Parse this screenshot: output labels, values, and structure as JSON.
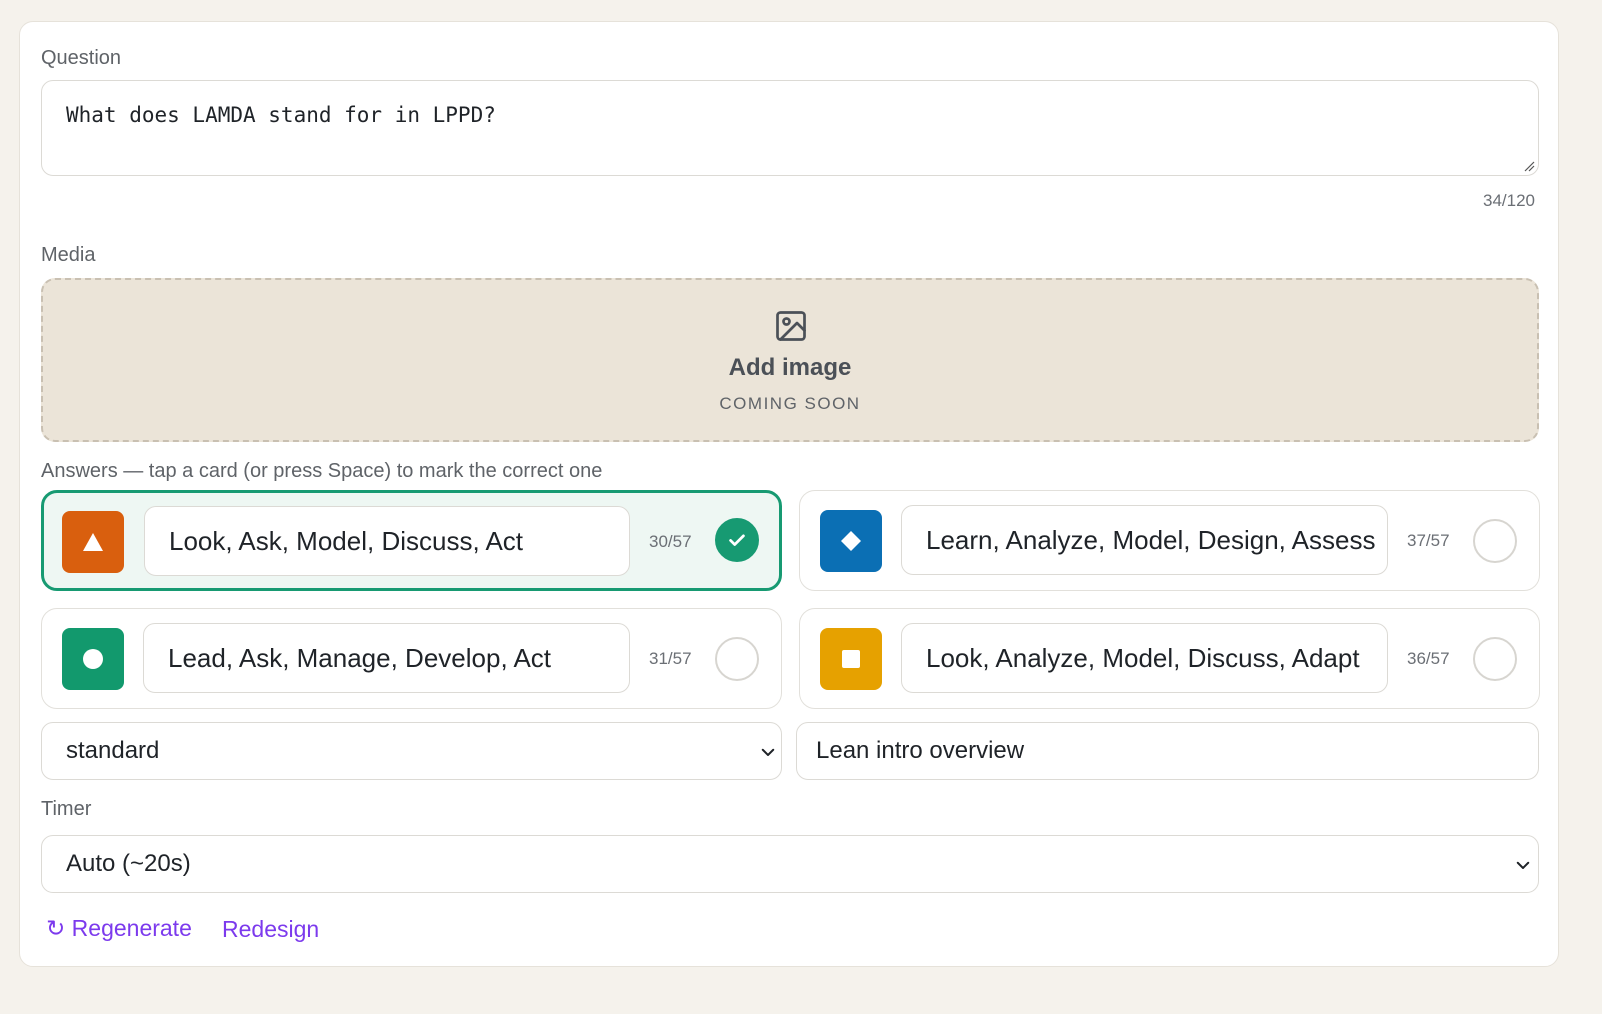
{
  "question": {
    "label": "Question",
    "value": "What does LAMDA stand for in LPPD?",
    "counter": "34/120"
  },
  "media": {
    "label": "Media",
    "title": "Add image",
    "subtitle": "COMING SOON",
    "icon": "image-icon"
  },
  "answers": {
    "label": "Answers — tap a card (or press Space) to mark the correct one",
    "items": [
      {
        "text": "Look, Ask, Model, Discuss, Act",
        "count": "30/57",
        "shape": "triangle",
        "color": "#d95f0e",
        "correct": true
      },
      {
        "text": "Learn, Analyze, Model, Design, Assess",
        "count": "37/57",
        "shape": "diamond",
        "color": "#0b6fb4",
        "correct": false
      },
      {
        "text": "Lead, Ask, Manage, Develop, Act",
        "count": "31/57",
        "shape": "circle",
        "color": "#12996d",
        "correct": false
      },
      {
        "text": "Look, Analyze, Model, Discuss, Adapt",
        "count": "36/57",
        "shape": "square",
        "color": "#e6a100",
        "correct": false
      }
    ]
  },
  "mode_select": {
    "value": "standard"
  },
  "topic_input": {
    "value": "Lean intro overview"
  },
  "timer": {
    "label": "Timer",
    "value": "Auto (~20s)"
  },
  "actions": {
    "regenerate": "↻ Regenerate",
    "redesign": "Redesign"
  },
  "colors": {
    "accent": "#7c3aed",
    "correct": "#179a72",
    "background": "#f5f2ec",
    "media_bg": "#ebe4d8"
  }
}
